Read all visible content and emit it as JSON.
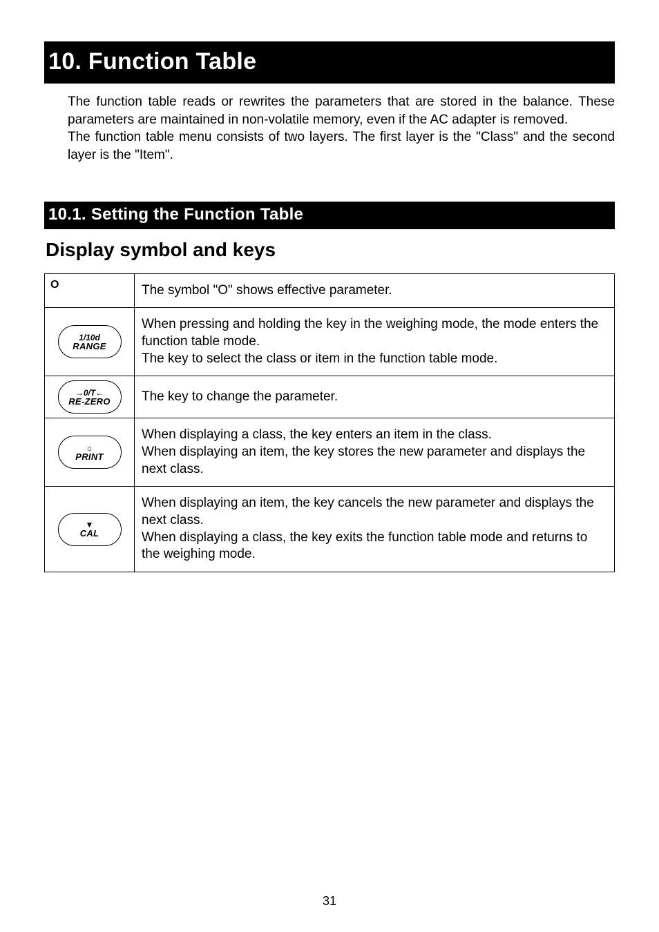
{
  "chapter": {
    "title": "10.  Function Table"
  },
  "intro": {
    "p1": "The function table reads or rewrites the parameters that are stored in the balance. These parameters are maintained in non-volatile memory, even if the AC adapter is removed.",
    "p2": "The function table menu consists of two layers. The first layer is the \"Class\" and the second layer is the \"Item\"."
  },
  "section": {
    "title": "10.1.  Setting the Function Table"
  },
  "subheading": "Display symbol and keys",
  "rows": {
    "r0": {
      "icon_text": "O",
      "desc": "The symbol \"O\" shows effective parameter."
    },
    "r1": {
      "key_top": "1/10d",
      "key_bot": "RANGE",
      "desc_l1": "When pressing and holding the key in the weighing mode, the mode enters the function table mode.",
      "desc_l2": "The key to select the class or item in the function table mode."
    },
    "r2": {
      "key_top": "→0/T←",
      "key_bot": "RE-ZERO",
      "desc": "The key to change the parameter."
    },
    "r3": {
      "key_top": "☼",
      "key_bot": "PRINT",
      "desc_l1": "When displaying a class, the key enters an item in the class.",
      "desc_l2": "When displaying an item, the key stores the new parameter and displays the next class."
    },
    "r4": {
      "key_top": "▼",
      "key_bot": "CAL",
      "desc_l1": "When displaying an item, the key cancels the new parameter and displays the next class.",
      "desc_l2": "When displaying a class, the key exits the function table mode and returns to the weighing mode."
    }
  },
  "page_number": "31"
}
